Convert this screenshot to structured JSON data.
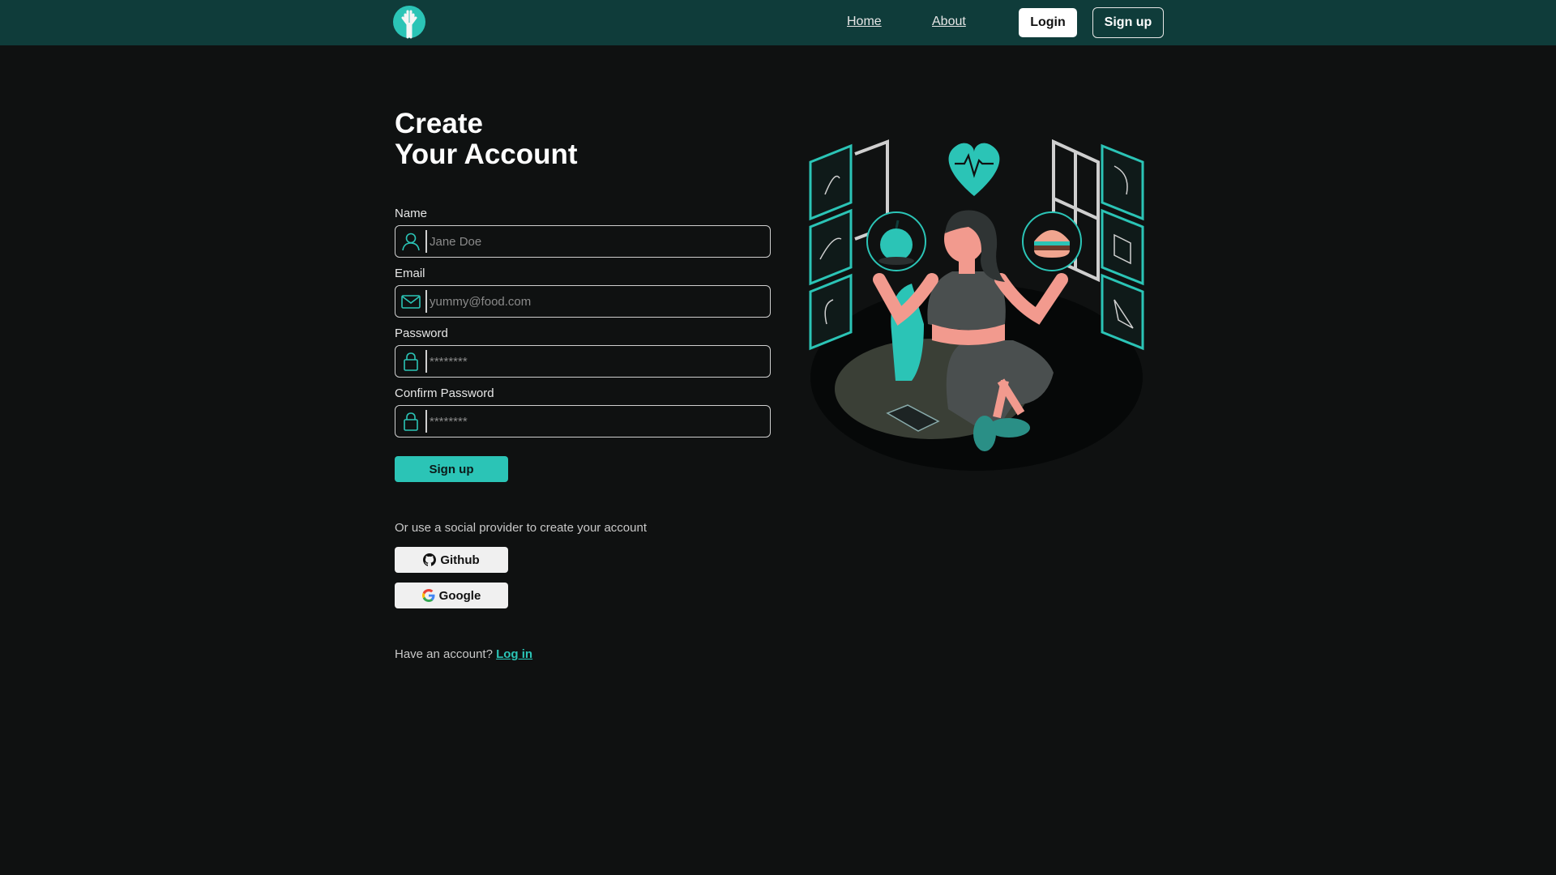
{
  "nav": {
    "home": "Home",
    "about": "About",
    "login": "Login",
    "signup": "Sign up"
  },
  "title": {
    "line1": "Create",
    "line2": "Your Account"
  },
  "form": {
    "name_label": "Name",
    "name_placeholder": "Jane Doe",
    "email_label": "Email",
    "email_placeholder": "yummy@food.com",
    "password_label": "Password",
    "password_placeholder": "********",
    "confirm_label": "Confirm Password",
    "confirm_placeholder": "********",
    "submit": "Sign up"
  },
  "social": {
    "prompt": "Or use a social provider to create your account",
    "github": "Github",
    "google": "Google"
  },
  "footer": {
    "question": "Have an account?",
    "login_link": "Log in"
  },
  "icons": {
    "logo": "tree-logo-icon",
    "name": "user-icon",
    "email": "envelope-icon",
    "password": "lock-icon",
    "github": "github-icon",
    "google": "google-icon"
  },
  "colors": {
    "header_bg": "#0f3c3a",
    "page_bg": "#0f1111",
    "accent": "#2bc4b6"
  }
}
